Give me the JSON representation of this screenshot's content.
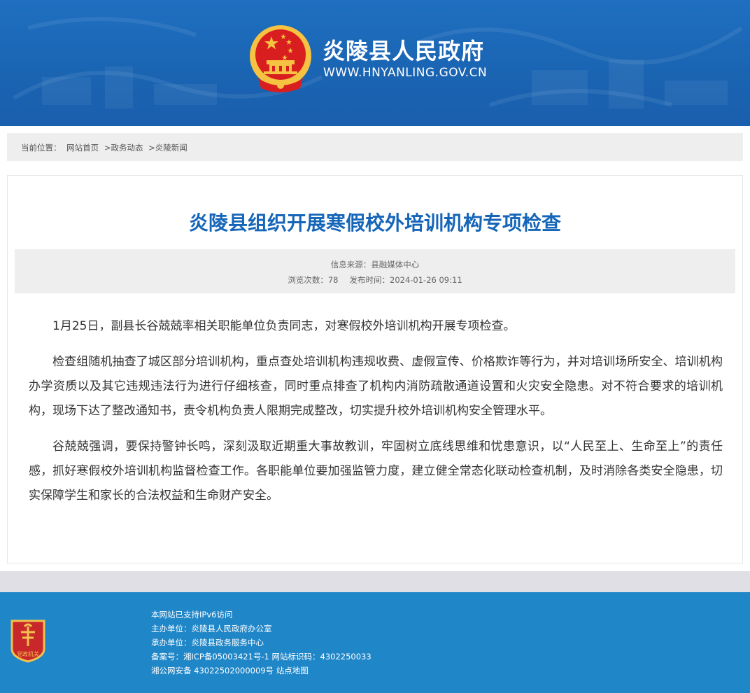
{
  "header": {
    "site_name": "炎陵县人民政府",
    "site_url": "WWW.HNYANLING.GOV.CN"
  },
  "breadcrumb": {
    "current_label": "当前位置：",
    "items": [
      "网站首页",
      ">政务动态",
      ">炎陵新闻"
    ]
  },
  "article": {
    "title": "炎陵县组织开展寒假校外培训机构专项检查",
    "source": "信息来源：县融媒体中心",
    "views_label": "浏览次数：",
    "views": "78",
    "date_label": "发布时间：",
    "date": "2024-01-26 09:11",
    "paragraphs": [
      "1月25日，副县长谷兢兢率相关职能单位负责同志，对寒假校外培训机构开展专项检查。",
      "检查组随机抽查了城区部分培训机构，重点查处培训机构违规收费、虚假宣传、价格欺诈等行为，并对培训场所安全、培训机构办学资质以及其它违规违法行为进行仔细核查，同时重点排查了机构内消防疏散通道设置和火灾安全隐患。对不符合要求的培训机构，现场下达了整改通知书，责令机构负责人限期完成整改，切实提升校外培训机构安全管理水平。",
      "谷兢兢强调，要保持警钟长鸣，深刻汲取近期重大事故教训，牢固树立底线思维和忧患意识，以“人民至上、生命至上”的责任感，抓好寒假校外培训机构监督检查工作。各职能单位要加强监管力度，建立健全常态化联动检查机制，及时消除各类安全隐患，切实保障学生和家长的合法权益和生命财产安全。"
    ]
  },
  "footer": {
    "badge_text": "党政机关",
    "lines": [
      "本网站已支持IPv6访问",
      "主办单位：炎陵县人民政府办公室",
      "承办单位：炎陵县政务服务中心",
      "备案号：湘ICP备05003421号-1 网站标识码：4302250033",
      "湘公网安备 43022502000009号 站点地图"
    ]
  },
  "colors": {
    "header_blue": "#1a64b2",
    "title_blue": "#1565b8",
    "footer_blue": "#1f86c8",
    "emblem_red": "#d81e1e",
    "emblem_gold": "#f5c242"
  }
}
